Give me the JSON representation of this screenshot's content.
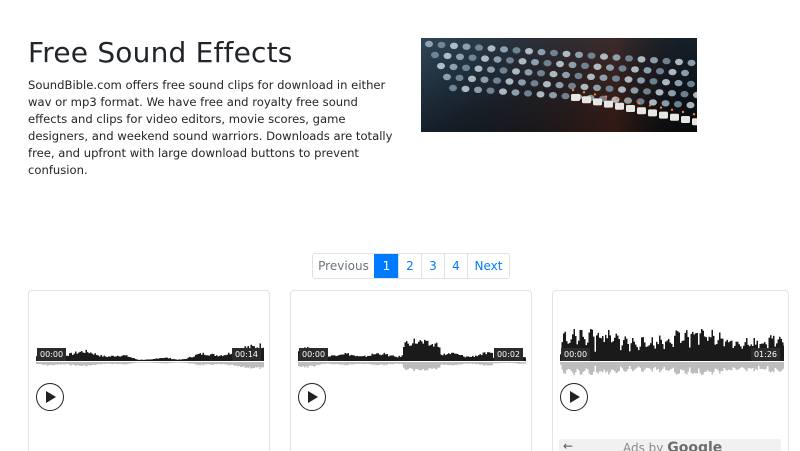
{
  "header": {
    "title": "Free Sound Effects",
    "intro": "SoundBible.com offers free sound clips for download in either wav or mp3 format. We have free and royalty free sound effects and clips for video editors, movie scores, game designers, and weekend sound warriors. Downloads are totally free, and upfront with large download buttons to prevent confusion."
  },
  "pagination": {
    "previous": "Previous",
    "pages": [
      "1",
      "2",
      "3",
      "4"
    ],
    "next": "Next",
    "active_page": "1"
  },
  "players": [
    {
      "start_time": "00:00",
      "duration": "00:14",
      "play_icon": "play-icon"
    },
    {
      "start_time": "00:00",
      "duration": "00:02",
      "play_icon": "play-icon"
    },
    {
      "start_time": "00:00",
      "duration": "01:26",
      "play_icon": "play-icon"
    }
  ],
  "ad": {
    "label": "Ads by",
    "brand": "Google",
    "back_icon": "arrow-left-icon"
  },
  "colors": {
    "accent": "#007bff",
    "waveform": "#1a1a1a",
    "waveform_reflection": "#bdbdbd"
  }
}
